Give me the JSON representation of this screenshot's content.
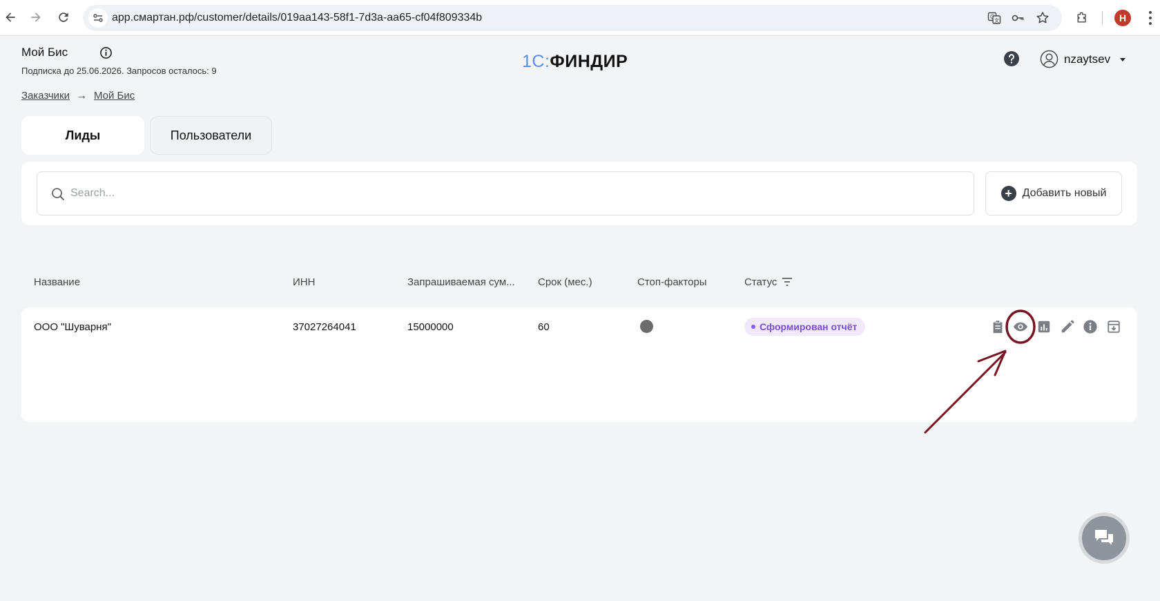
{
  "browser": {
    "url": "app.смартан.рф/customer/details/019aa143-58f1-7d3a-aa65-cf04f809334b",
    "profile_initial": "Н",
    "icons": [
      "back-icon",
      "forward-icon",
      "reload-icon",
      "site-settings-icon",
      "translate-icon",
      "password-key-icon",
      "bookmark-star-icon",
      "extensions-icon",
      "menu-dots-icon"
    ]
  },
  "header": {
    "company_name": "Мой Бис",
    "subscription": "Подписка до 25.06.2026. Запросов осталось: 9",
    "logo_prefix": "1С:",
    "logo_name": "ФИНДИР",
    "username": "nzaytsev"
  },
  "breadcrumb": {
    "items": [
      "Заказчики",
      "Мой Бис"
    ],
    "separator": "→"
  },
  "tabs": [
    {
      "label": "Лиды",
      "active": true
    },
    {
      "label": "Пользователи",
      "active": false
    }
  ],
  "search": {
    "placeholder": "Search...",
    "value": ""
  },
  "add_button": {
    "label": "Добавить новый"
  },
  "table": {
    "columns": [
      "Название",
      "ИНН",
      "Запрашиваемая сум...",
      "Срок (мес.)",
      "Стоп-факторы",
      "Статус"
    ],
    "rows": [
      {
        "name": "ООО \"Шуварня\"",
        "inn": "37027264041",
        "amount": "15000000",
        "term": "60",
        "status": "Сформирован отчёт"
      }
    ],
    "row_actions": [
      "clipboard-icon",
      "eye-icon",
      "chart-icon",
      "edit-icon",
      "info-icon",
      "archive-icon"
    ]
  },
  "colors": {
    "page_bg": "#f3f4f6",
    "status_badge_bg": "#efe9fb",
    "status_badge_text": "#7a4fd0",
    "logo_accent": "#5b8def",
    "annotation": "#7a1424"
  }
}
